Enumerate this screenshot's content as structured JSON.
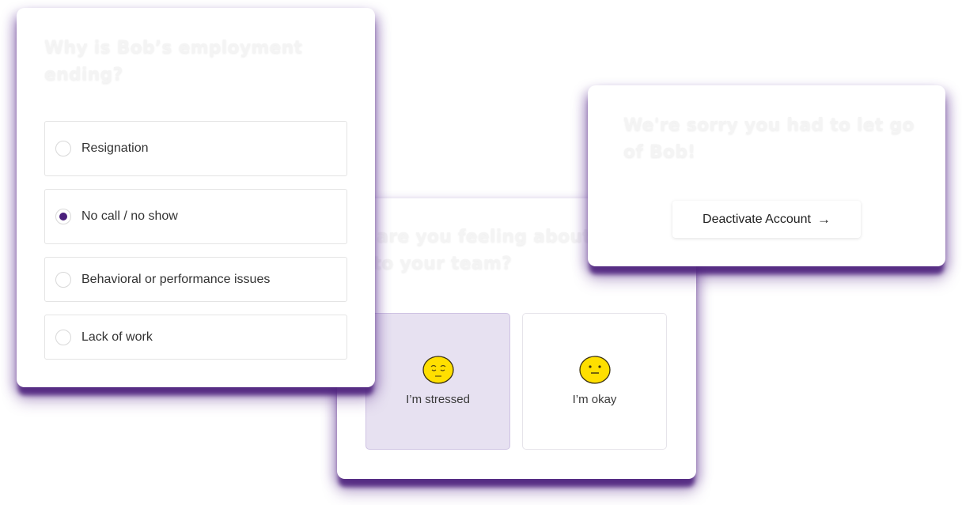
{
  "colors": {
    "accent": "#4a1f7c",
    "selected_tile_bg": "#e7e1f1",
    "emoji_yellow": "#ffdf00"
  },
  "reason_card": {
    "heading": "Why is Bob’s employment ending?",
    "options": [
      {
        "label": "Resignation",
        "selected": false
      },
      {
        "label": "No call / no show",
        "selected": true
      },
      {
        "label": "Behavioral or performance issues",
        "selected": false
      },
      {
        "label": "Lack of work",
        "selected": false
      }
    ]
  },
  "feeling_card": {
    "heading": "How are you feeling about this loss to your team?",
    "heading_visible": "ow are you feeling abo… ss to your team?",
    "options": [
      {
        "label": "I’m stressed",
        "icon": "pensive-face-icon",
        "selected": true
      },
      {
        "label": "I’m okay",
        "icon": "neutral-face-icon",
        "selected": false
      }
    ]
  },
  "sorry_card": {
    "heading": "We're sorry you had to let go of Bob!",
    "button_label": "Deactivate Account",
    "button_icon": "arrow-right-icon",
    "button_icon_glyph": "→"
  }
}
